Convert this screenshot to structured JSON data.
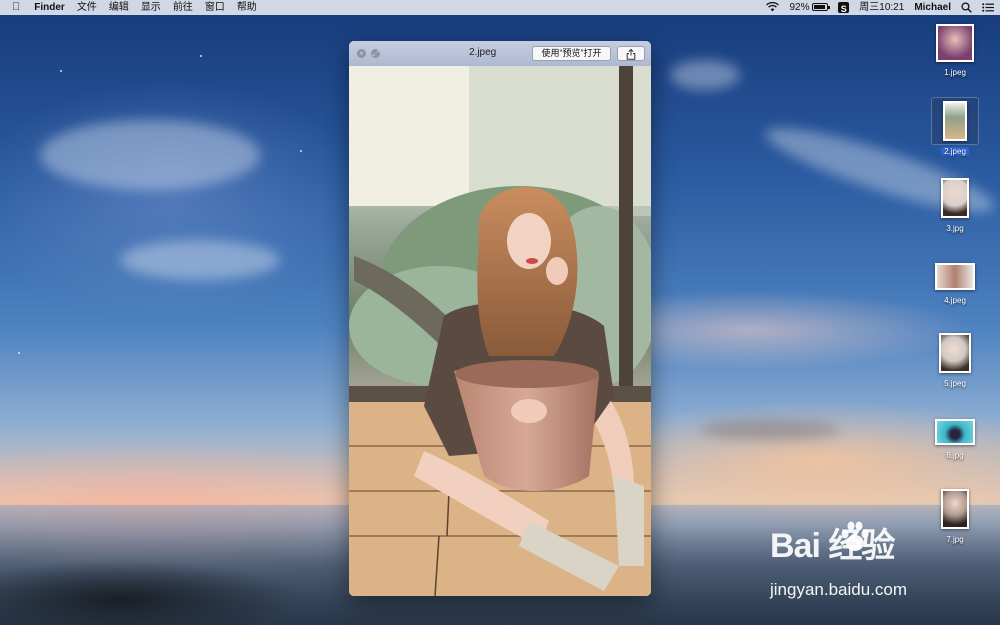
{
  "menubar": {
    "apple_icon": "apple-logo",
    "app_name": "Finder",
    "menus": [
      "文件",
      "编辑",
      "显示",
      "前往",
      "窗口",
      "帮助"
    ],
    "status": {
      "wifi_icon": "wifi-icon",
      "battery_percent": "92%",
      "battery_level": 0.92,
      "sogou_icon": "S",
      "datetime": "周三10:21",
      "user": "Michael",
      "search_icon": "search-icon",
      "notification_icon": "list-icon"
    }
  },
  "quicklook": {
    "title": "2.jpeg",
    "open_with_label": "使用“预览”打开",
    "share_icon": "share-icon",
    "close_icon": "close-icon",
    "fullscreen_icon": "fullscreen-icon"
  },
  "desktop_icons": [
    {
      "label": "1.jpeg",
      "selected": false
    },
    {
      "label": "2.jpeg",
      "selected": true
    },
    {
      "label": "3.jpg",
      "selected": false
    },
    {
      "label": "4.jpeg",
      "selected": false
    },
    {
      "label": "5.jpeg",
      "selected": false
    },
    {
      "label": "6.jpg",
      "selected": false
    },
    {
      "label": "7.jpg",
      "selected": false
    }
  ],
  "watermark": {
    "logo_text": "Bai  经验",
    "url": "jingyan.baidu.com"
  }
}
